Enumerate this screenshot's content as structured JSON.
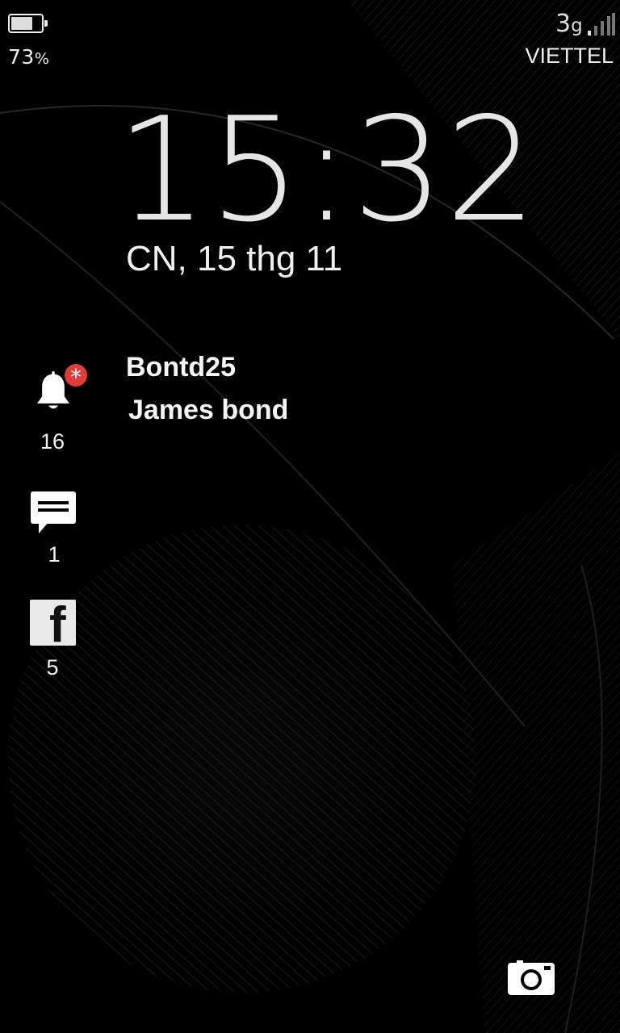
{
  "status_bar": {
    "battery_level": 0.73,
    "battery_percent": "73",
    "battery_unit": "%",
    "network_type": "3",
    "network_type_suffix": "g",
    "signal_level": 0.25,
    "carrier": "VIETTEL"
  },
  "lock_screen": {
    "time": "15:32",
    "date": "CN, 15 thg 11"
  },
  "notifications": {
    "alerts": {
      "icon": "bell-icon",
      "count": "16",
      "badge_icon": "asterisk-icon"
    },
    "messages": {
      "icon": "message-icon",
      "count": "1"
    },
    "facebook": {
      "icon": "facebook-icon",
      "glyph": "f",
      "count": "5"
    },
    "preview_lines": [
      "Bontd25",
      "James bond"
    ]
  },
  "actions": {
    "camera_icon": "camera-icon"
  },
  "colors": {
    "background": "#000000",
    "text": "#ffffff",
    "badge": "#e23b3b",
    "icon_tile": "#e9e9e9"
  }
}
